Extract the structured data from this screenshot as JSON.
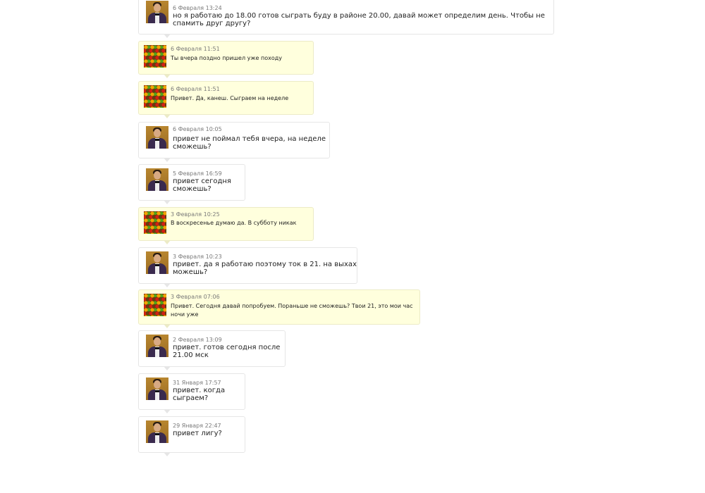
{
  "messages": [
    {
      "author": "other",
      "date": "6 Февраля 13:24",
      "lines": [
        "но я работаю до 18.00 готов сыграть буду в районе 20.00, давай может определим день. Чтобы не",
        "спамить друг другу?"
      ]
    },
    {
      "author": "self",
      "date": "6 Февраля 11:51",
      "lines": [
        "Ты вчера поздно пришел уже походу"
      ]
    },
    {
      "author": "self",
      "date": "6 Февраля 11:51",
      "lines": [
        "Привет. Да, канеш. Сыграем на неделе"
      ]
    },
    {
      "author": "other",
      "date": "6 Февраля 10:05",
      "lines": [
        "привет не поймал тебя вчера, на неделе",
        "сможешь?"
      ]
    },
    {
      "author": "other",
      "date": "5 Февраля 16:59",
      "lines": [
        "привет сегодня",
        "сможешь?"
      ]
    },
    {
      "author": "self",
      "date": "3 Февраля 10:25",
      "lines": [
        "В воскресенье думаю да. В субботу никак"
      ]
    },
    {
      "author": "other",
      "date": "3 Февраля 10:23",
      "lines": [
        "привет. да я работаю поэтому ток в 21. на выхах",
        "можешь?"
      ]
    },
    {
      "author": "self",
      "date": "3 Февраля 07:06",
      "lines": [
        "Привет. Сегодня давай попробуем. Пораньше не сможешь? Твои 21, это мои час",
        "ночи уже"
      ]
    },
    {
      "author": "other",
      "date": "2 Февраля 13:09",
      "lines": [
        "привет. готов сегодня после",
        "21.00 мск"
      ]
    },
    {
      "author": "other",
      "date": "31 Января 17:57",
      "lines": [
        "привет. когда",
        "сыграем?"
      ]
    },
    {
      "author": "other",
      "date": "29 Января 22:47",
      "lines": [
        "привет лигу?"
      ]
    }
  ]
}
